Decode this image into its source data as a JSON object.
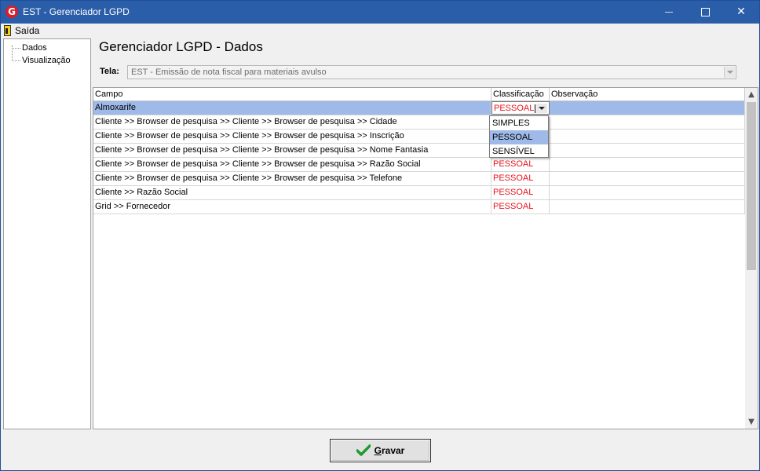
{
  "window": {
    "title": "EST - Gerenciador LGPD",
    "app_icon_letter": "G"
  },
  "menu": {
    "exit_label": "Saída"
  },
  "tree": {
    "items": [
      "Dados",
      "Visualização"
    ]
  },
  "main": {
    "heading": "Gerenciador LGPD - Dados",
    "tela_label": "Tela:",
    "tela_value": "EST - Emissão de nota fiscal para materiais avulso"
  },
  "grid": {
    "columns": [
      "Campo",
      "Classificação",
      "Observação"
    ],
    "rows": [
      {
        "campo": "Almoxarife",
        "classificacao": "PESSOAL",
        "observacao": ""
      },
      {
        "campo": "Cliente >> Browser de pesquisa >> Cliente >> Browser de pesquisa >> Cidade",
        "classificacao": "",
        "observacao": ""
      },
      {
        "campo": "Cliente >> Browser de pesquisa >> Cliente >> Browser de pesquisa >> Inscrição",
        "classificacao": "",
        "observacao": ""
      },
      {
        "campo": "Cliente >> Browser de pesquisa >> Cliente >> Browser de pesquisa >> Nome Fantasia",
        "classificacao": "",
        "observacao": ""
      },
      {
        "campo": "Cliente >> Browser de pesquisa >> Cliente >> Browser de pesquisa >> Razão Social",
        "classificacao": "PESSOAL",
        "observacao": ""
      },
      {
        "campo": "Cliente >> Browser de pesquisa >> Cliente >> Browser de pesquisa >> Telefone",
        "classificacao": "PESSOAL",
        "observacao": ""
      },
      {
        "campo": "Cliente >> Razão Social",
        "classificacao": "PESSOAL",
        "observacao": ""
      },
      {
        "campo": "Grid >> Fornecedor",
        "classificacao": "PESSOAL",
        "observacao": ""
      }
    ],
    "dropdown_options": [
      "SIMPLES",
      "PESSOAL",
      "SENSÍVEL"
    ],
    "dropdown_highlighted": "PESSOAL"
  },
  "footer": {
    "save_label_underlined": "G",
    "save_label_rest": "ravar"
  },
  "colors": {
    "titlebar": "#2b5ea8",
    "selection": "#9fb9e8",
    "classification_text": "#e4161e",
    "check": "#1f9b2e"
  }
}
